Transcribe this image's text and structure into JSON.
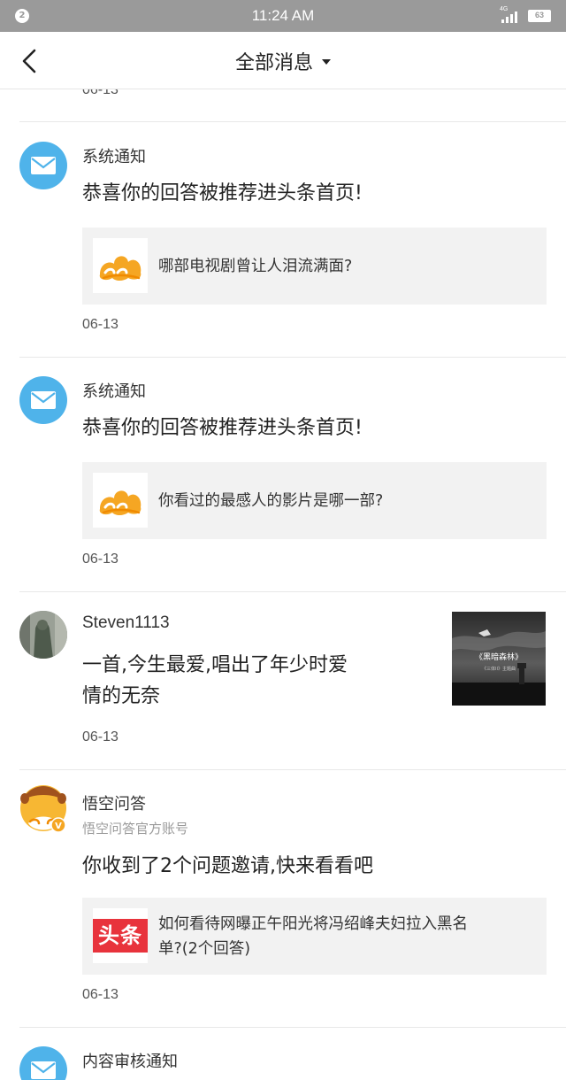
{
  "status_bar": {
    "badge": "2",
    "time": "11:24 AM",
    "network": "4G",
    "battery": "63"
  },
  "header": {
    "back_icon": "chevron-left-icon",
    "title": "全部消息",
    "dropdown_icon": "caret-down-icon"
  },
  "messages": [
    {
      "date": "06-13"
    },
    {
      "type": "system",
      "avatar_icon": "mail-icon",
      "sender": "系统通知",
      "content": "恭喜你的回答被推荐进头条首页!",
      "card": {
        "thumb_icon": "wukong-logo-icon",
        "text": "哪部电视剧曾让人泪流满面?"
      },
      "date": "06-13"
    },
    {
      "type": "system",
      "avatar_icon": "mail-icon",
      "sender": "系统通知",
      "content": "恭喜你的回答被推荐进头条首页!",
      "card": {
        "thumb_icon": "wukong-logo-icon",
        "text": "你看过的最感人的影片是哪一部?"
      },
      "date": "06-13"
    },
    {
      "type": "user",
      "avatar_icon": "user-photo-avatar",
      "sender": "Steven1113",
      "content_line1": "一首,今生最爱,唱出了年少时爱",
      "content_line2": "情的无奈",
      "preview": {
        "title": "《黑暗森林》",
        "subtitle": "《三体II》主题曲"
      },
      "date": "06-13"
    },
    {
      "type": "official",
      "avatar_icon": "wukong-avatar",
      "sender": "悟空问答",
      "sub_sender": "悟空问答官方账号",
      "content": "你收到了2个问题邀请,快来看看吧",
      "card": {
        "thumb_label": "头条",
        "text_line1": "如何看待网曝正午阳光将冯绍峰夫妇拉入黑名",
        "text_line2": "单?(2个回答)"
      },
      "date": "06-13"
    },
    {
      "type": "system",
      "avatar_icon": "mail-icon",
      "sender": "内容审核通知"
    }
  ],
  "colors": {
    "status_bar_bg": "#9a9a9a",
    "mail_avatar_bg": "#4fb3ea",
    "card_bg": "#f2f2f2",
    "toutiao_red": "#e8333c",
    "wukong_orange": "#f5a623"
  }
}
